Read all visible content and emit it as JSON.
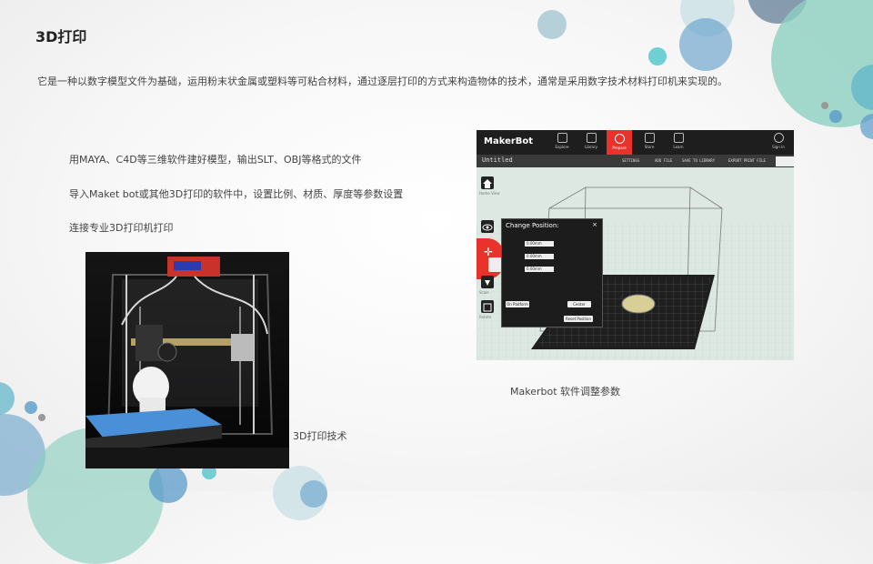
{
  "slide": {
    "title": "3D打印",
    "description": "它是一种以数字模型文件为基础，运用粉末状金属或塑料等可粘合材料，通过逐层打印的方式来构造物体的技术，通常是采用数字技术材料打印机来实现的。",
    "steps": [
      "用MAYA、C4D等三维软件建好模型，输出SLT、OBJ等格式的文件",
      "导入Maket bot或其他3D打印的软件中，设置比例、材质、厚度等参数设置",
      "连接专业3D打印机打印"
    ],
    "photo_caption": "3D打印技术",
    "screenshot_caption": "Makerbot 软件调整参数"
  },
  "makerbot": {
    "logo": "MakerBot",
    "nav": [
      "Explore",
      "Library",
      "Prepare",
      "Store",
      "Learn"
    ],
    "sign_in": "Sign In",
    "file_name": "Untitled",
    "actions": [
      "SETTINGS",
      "ADD FILE",
      "SAVE TO LIBRARY",
      "EXPORT PRINT FILE"
    ],
    "dialog_title": "Change Position:",
    "dialog_close": "×",
    "fields": [
      "0.00mm",
      "0.00mm",
      "0.00mm"
    ],
    "on_platform": "On Platform",
    "center": "Center",
    "reset_position": "Reset Position",
    "side_labels": [
      "Home View",
      "Move",
      "Scale",
      "Rotate"
    ]
  },
  "colors": {
    "accent_red": "#e8322b",
    "circle_teal": "#6ec4c9",
    "circle_mint": "#8dcfc0",
    "circle_blue": "#5b9bc9"
  }
}
